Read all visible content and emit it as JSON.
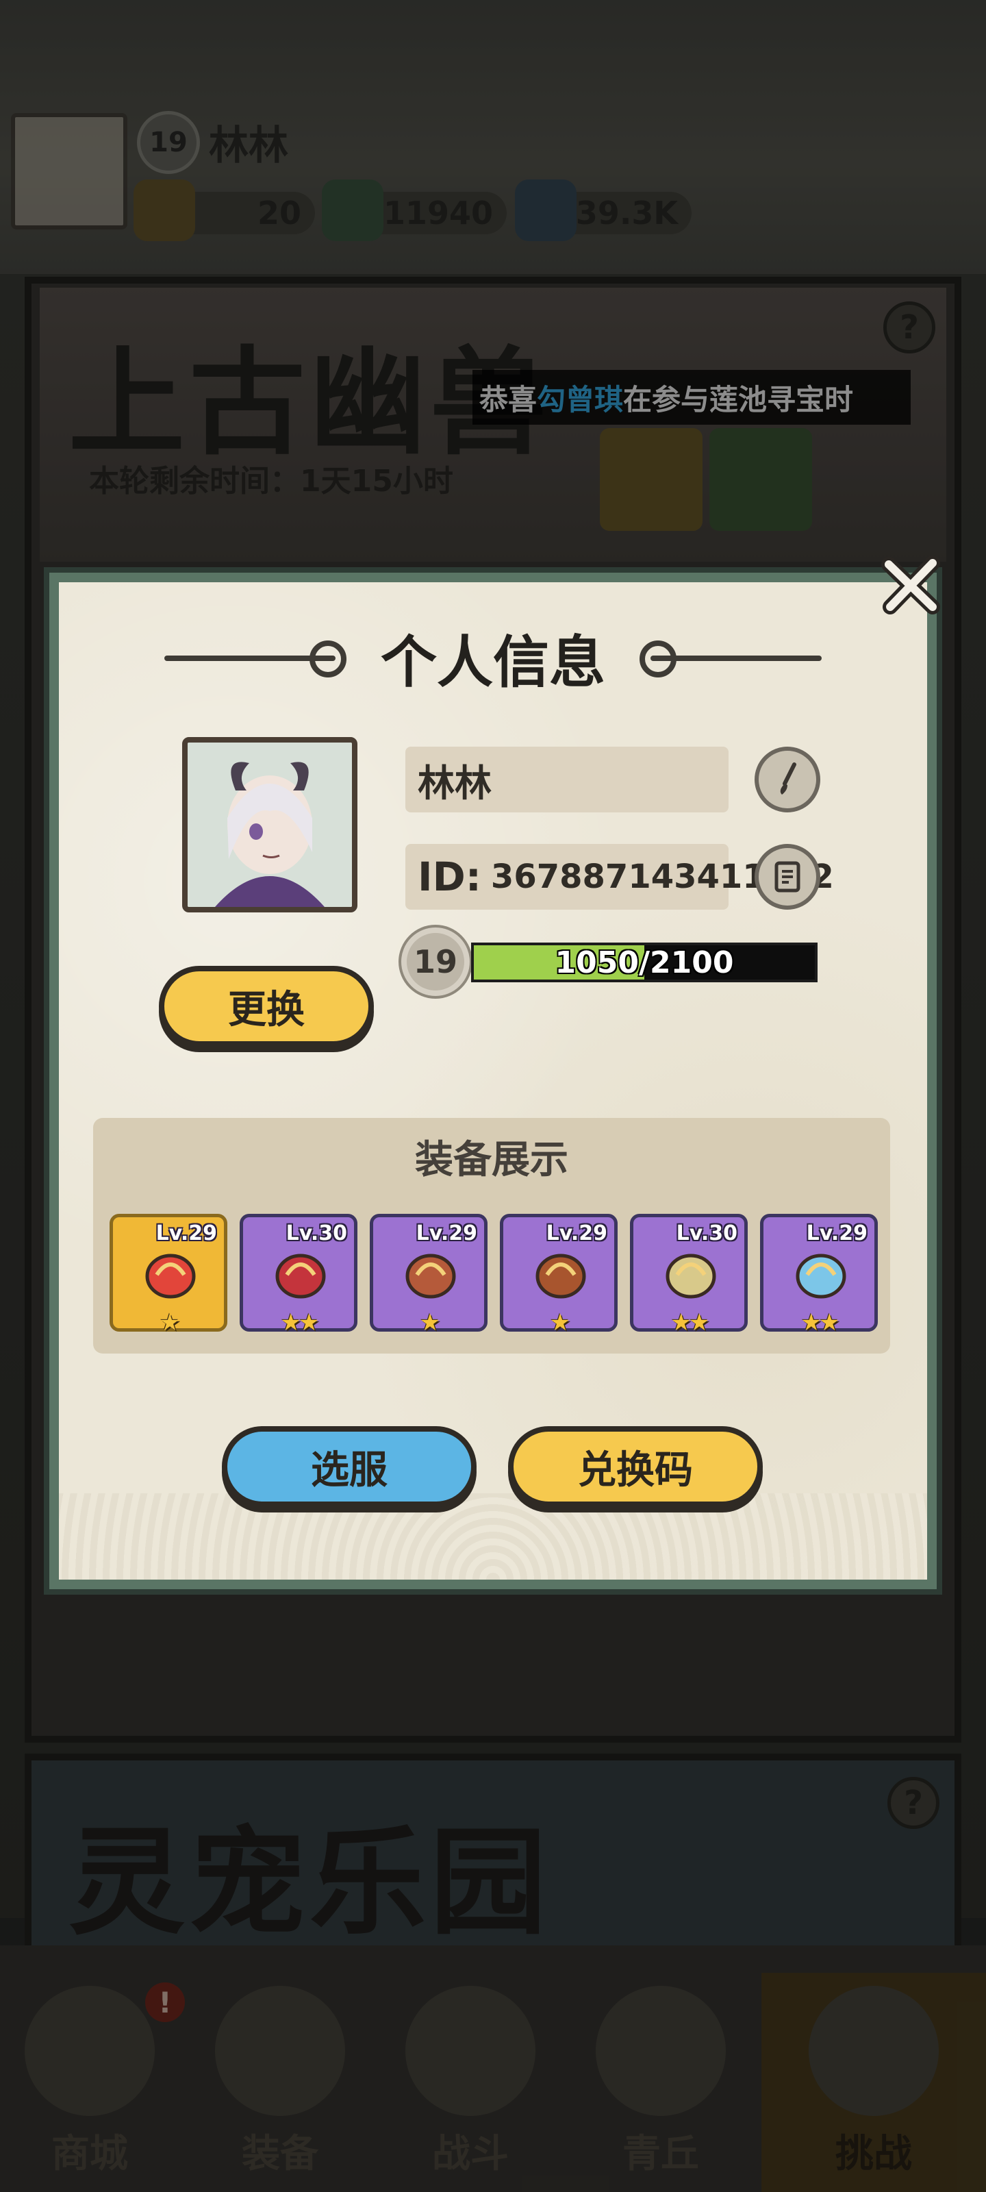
{
  "header": {
    "player_name": "林林",
    "level": "19",
    "resources": [
      {
        "name": "scroll-currency",
        "value": "20"
      },
      {
        "name": "jade-currency",
        "value": "11940"
      },
      {
        "name": "crystal-currency",
        "value": "339.3K"
      }
    ]
  },
  "event_banner": {
    "title": "上古幽兽",
    "remaining_time": "本轮剩余时间：1天15小时",
    "help": "?",
    "ticker": {
      "prefix": "恭喜 ",
      "highlight": "勾曾琪",
      "suffix": " 在参与莲池寻宝时"
    }
  },
  "second_banner": {
    "title": "灵宠乐园",
    "help": "?"
  },
  "bottom_nav": {
    "items": [
      {
        "label": "商城",
        "alert": "!"
      },
      {
        "label": "装备"
      },
      {
        "label": "战斗"
      },
      {
        "label": "青丘"
      },
      {
        "label": "挑战"
      }
    ],
    "active_index": 4
  },
  "modal": {
    "title": "个人信息",
    "name": "林林",
    "id_label": "ID:",
    "id_value": "367887143411712",
    "level": "19",
    "xp_text": "1050/2100",
    "xp_fraction": 0.5,
    "change_avatar_label": "更换",
    "equipment_title": "装备展示",
    "equipment": [
      {
        "level": "Lv.29",
        "stars": "★",
        "rarity": "gold",
        "icon": "fan-weapon-icon"
      },
      {
        "level": "Lv.30",
        "stars": "★★",
        "rarity": "purple",
        "icon": "helmet-icon"
      },
      {
        "level": "Lv.29",
        "stars": "★",
        "rarity": "purple",
        "icon": "sash-icon"
      },
      {
        "level": "Lv.29",
        "stars": "★",
        "rarity": "purple",
        "icon": "belt-icon"
      },
      {
        "level": "Lv.30",
        "stars": "★★",
        "rarity": "purple",
        "icon": "boots-icon"
      },
      {
        "level": "Lv.29",
        "stars": "★★",
        "rarity": "purple",
        "icon": "crystal-amulet-icon"
      }
    ],
    "server_button": "选服",
    "redeem_button": "兑换码"
  }
}
